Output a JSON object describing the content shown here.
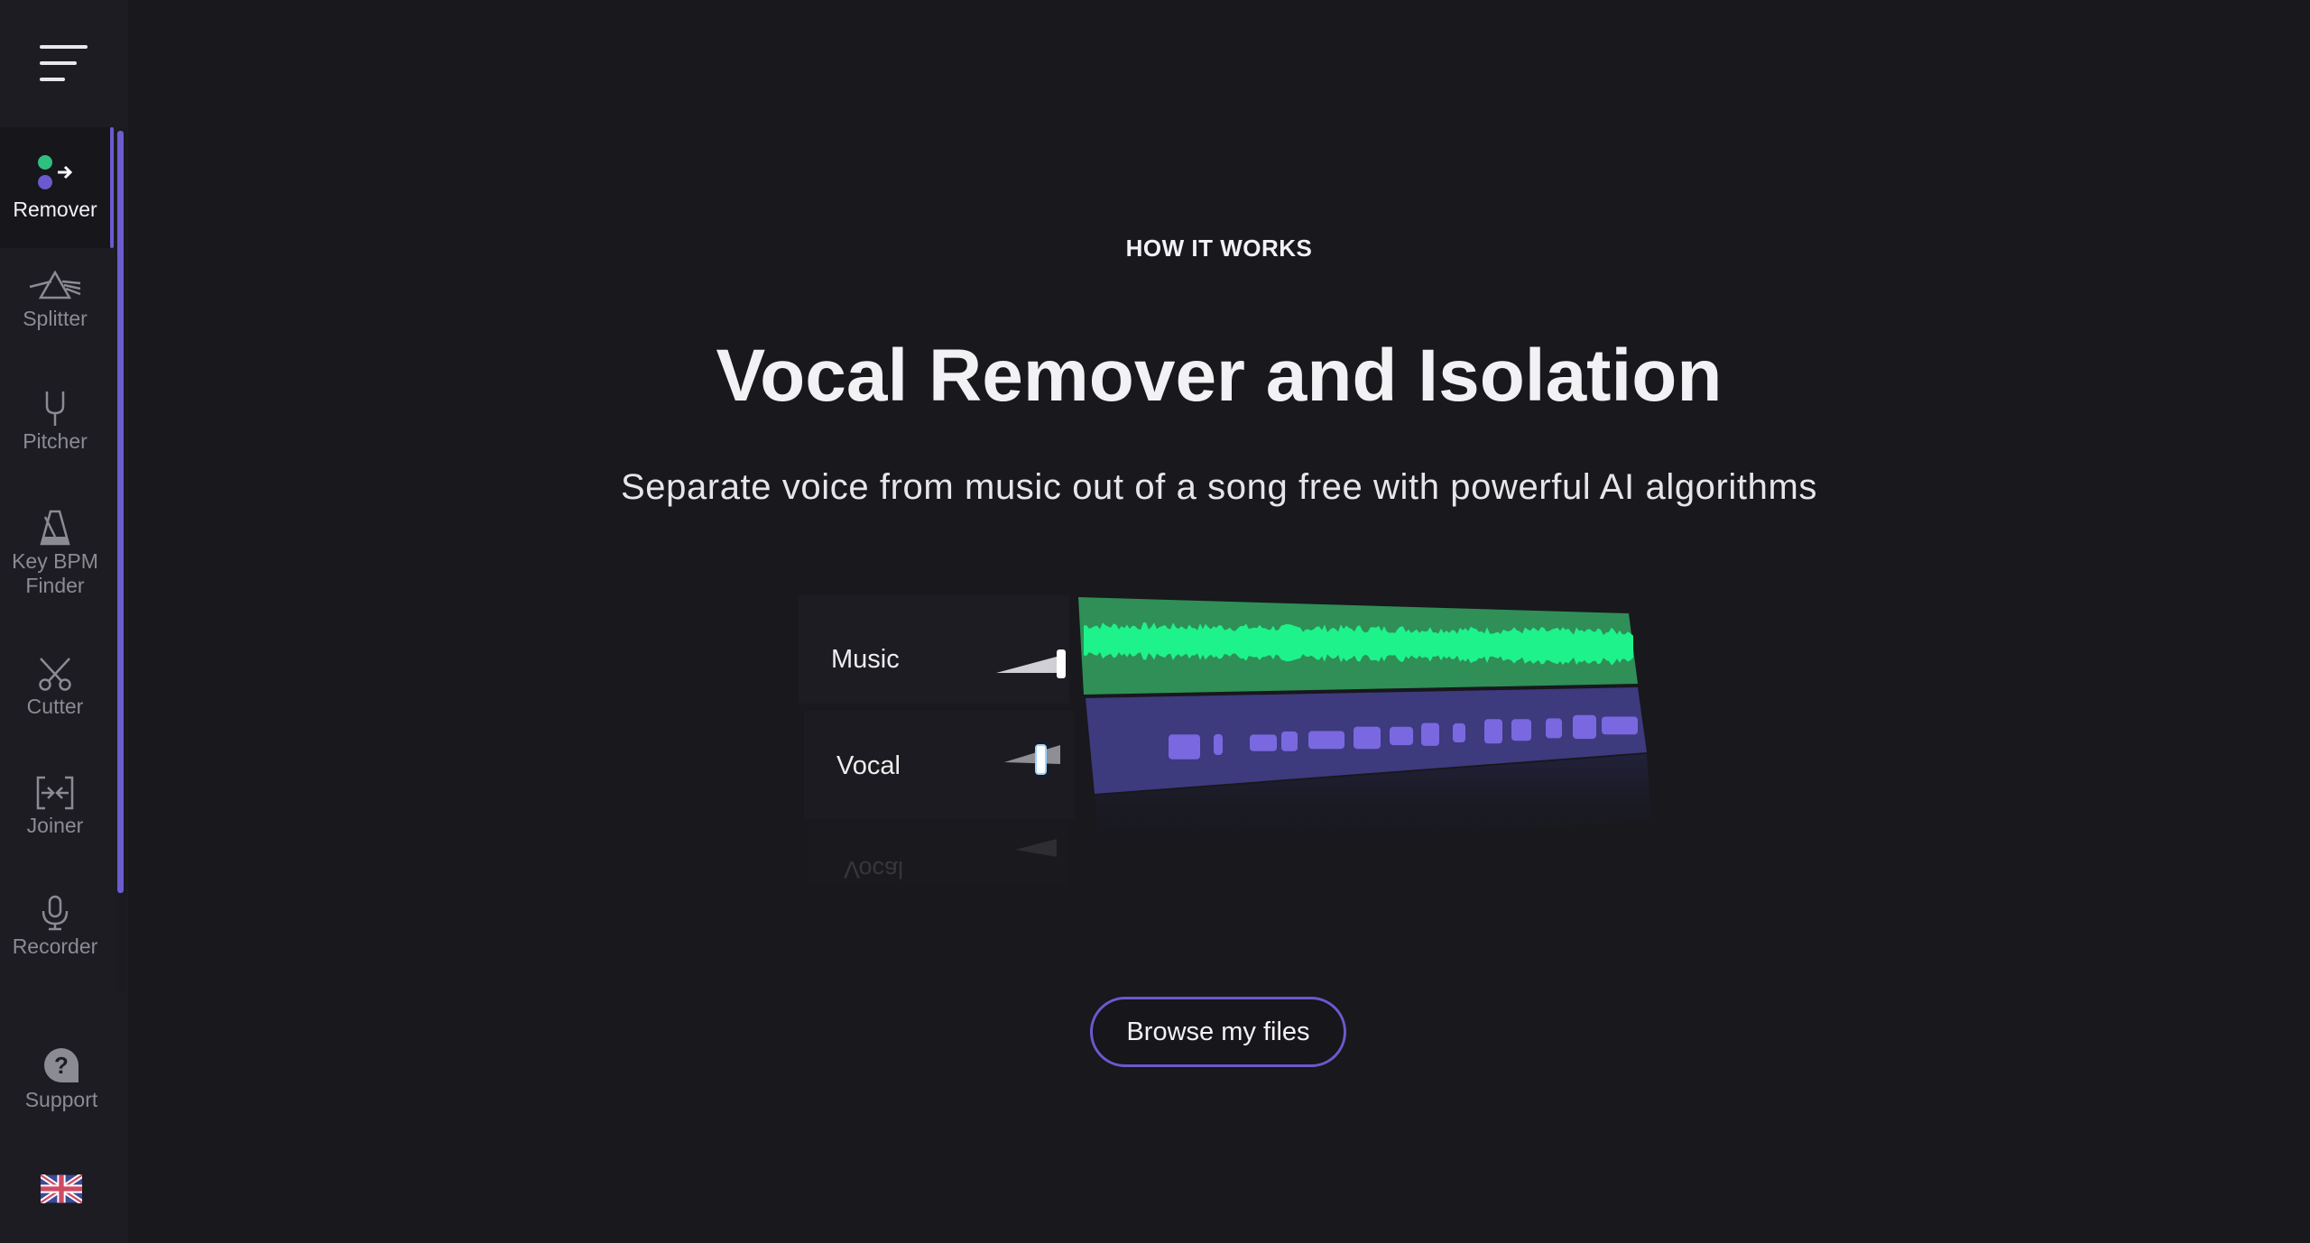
{
  "sidebar": {
    "menu_icon": "hamburger-menu-icon",
    "items": [
      {
        "label": "Remover",
        "icon": "remover-dots-arrow-icon",
        "active": true
      },
      {
        "label": "Splitter",
        "icon": "prism-icon",
        "active": false
      },
      {
        "label": "Pitcher",
        "icon": "tuning-fork-icon",
        "active": false
      },
      {
        "label": "Key BPM Finder",
        "icon": "metronome-icon",
        "active": false
      },
      {
        "label": "Cutter",
        "icon": "scissors-icon",
        "active": false
      },
      {
        "label": "Joiner",
        "icon": "join-arrows-icon",
        "active": false
      },
      {
        "label": "Recorder",
        "icon": "microphone-icon",
        "active": false
      }
    ],
    "support": {
      "label": "Support",
      "icon": "question-bubble-icon"
    },
    "language": {
      "icon": "uk-flag-icon"
    }
  },
  "hero": {
    "eyebrow": "HOW IT WORKS",
    "title": "Vocal Remover and Isolation",
    "subtitle": "Separate voice from music out of a song free with powerful AI algorithms"
  },
  "illustration": {
    "tracks": [
      {
        "label": "Music",
        "color": "#2f8f57",
        "wave_color": "#1ef28a",
        "volume": 1.0
      },
      {
        "label": "Vocal",
        "color": "#3d3a7e",
        "wave_color": "#7a68e0",
        "volume": 0.4
      }
    ],
    "reflection_label": "Vocal"
  },
  "cta": {
    "browse_label": "Browse my files"
  },
  "colors": {
    "accent": "#6a5acd",
    "background": "#18181d",
    "sidebar": "#1c1c22"
  }
}
